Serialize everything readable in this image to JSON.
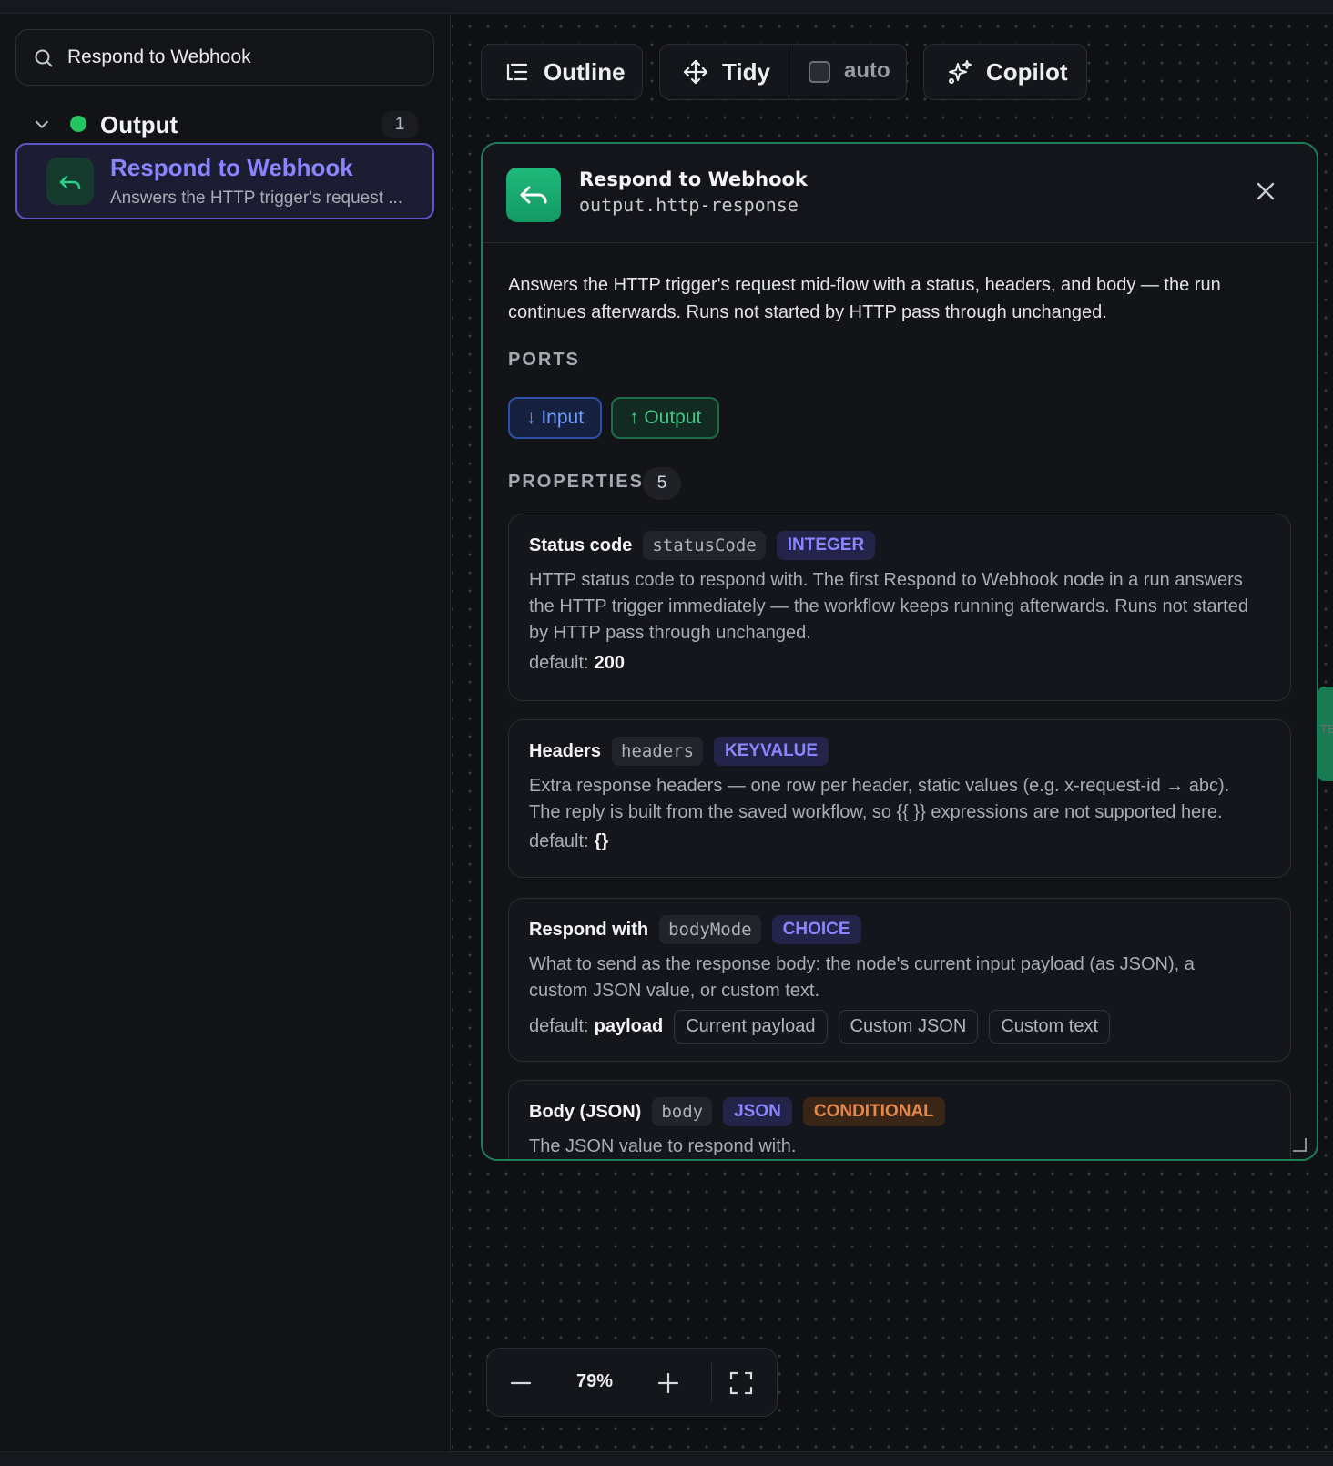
{
  "sidebar": {
    "search_value": "Respond to Webhook",
    "group": {
      "label": "Output",
      "count": "1",
      "dot_color": "#22c55e"
    },
    "node": {
      "title": "Respond to Webhook",
      "desc": "Answers the HTTP trigger's request ..."
    }
  },
  "toolbar": {
    "outline_label": "Outline",
    "tidy_label": "Tidy",
    "auto_label": "auto",
    "auto_checked": false,
    "copilot_label": "Copilot"
  },
  "panel": {
    "title": "Respond to Webhook",
    "subtitle": "output.http-response",
    "description": "Answers the HTTP trigger's request mid-flow with a status, headers, and body — the run continues afterwards. Runs not started by HTTP pass through unchanged.",
    "ports_label": "PORTS",
    "ports": {
      "input": "↓ Input",
      "output": "↑ Output"
    },
    "properties_label": "PROPERTIES",
    "properties_count": "5",
    "properties": [
      {
        "name": "Status code",
        "key": "statusCode",
        "type": "INTEGER",
        "desc": "HTTP status code to respond with. The first Respond to Webhook node in a run answers the HTTP trigger immediately — the workflow keeps running afterwards. Runs not started by HTTP pass through unchanged.",
        "default_label": "default:",
        "default_value": "200"
      },
      {
        "name": "Headers",
        "key": "headers",
        "type": "KEYVALUE",
        "desc": "Extra response headers — one row per header, static values (e.g. x-request-id → abc). The reply is built from the saved workflow, so {{ }} expressions are not supported here.",
        "default_label": "default:",
        "default_value": "{}"
      },
      {
        "name": "Respond with",
        "key": "bodyMode",
        "type": "CHOICE",
        "desc": "What to send as the response body: the node's current input payload (as JSON), a custom JSON value, or custom text.",
        "default_label": "default:",
        "default_value": "payload",
        "choices": [
          "Current payload",
          "Custom JSON",
          "Custom text"
        ]
      },
      {
        "name": "Body (JSON)",
        "key": "body",
        "type": "JSON",
        "flag": "CONDITIONAL",
        "desc": "The JSON value to respond with."
      }
    ]
  },
  "zoom": {
    "value": "79%"
  },
  "edge_label": "TE"
}
